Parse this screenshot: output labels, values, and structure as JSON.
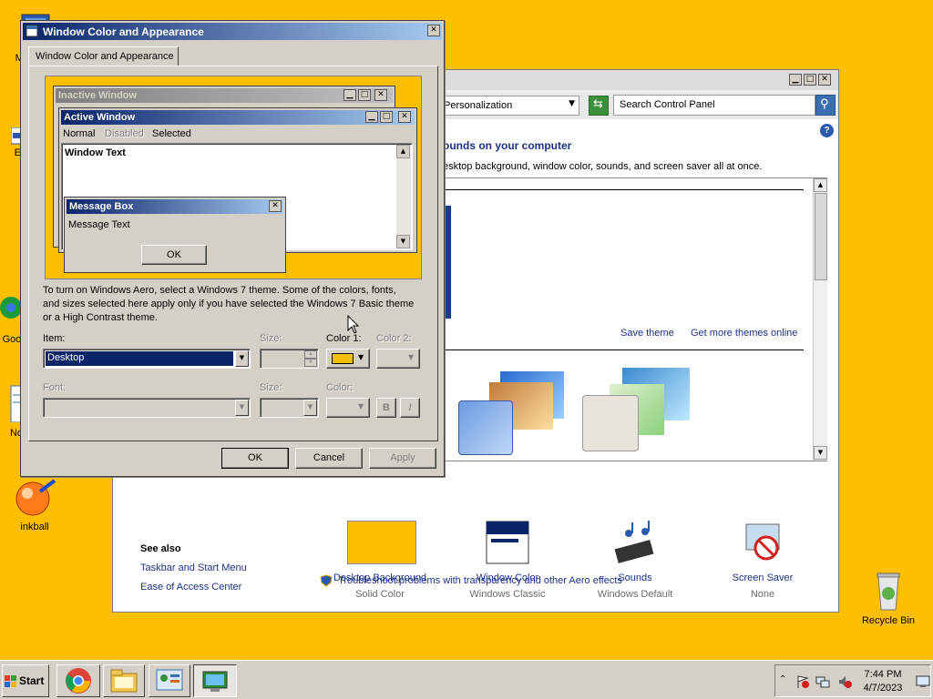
{
  "desktop": {
    "icons": [
      {
        "label": "My",
        "icon": "computer-icon"
      },
      {
        "label": "Ev",
        "icon": "document-icon"
      },
      {
        "label": "Goo",
        "icon": "chrome-icon"
      },
      {
        "label": "No",
        "icon": "notepad-icon"
      },
      {
        "label": "inkball",
        "icon": "inkball-icon"
      },
      {
        "label": "Recycle Bin",
        "icon": "recycle-bin-icon"
      }
    ]
  },
  "personalization": {
    "breadcrumb": "Personalization",
    "search_placeholder": "Search Control Panel",
    "heading": "ounds on your computer",
    "subheading": "esktop background, window color, sounds, and screen saver all at once.",
    "save_theme": "Save theme",
    "get_more_themes": "Get more themes online",
    "bottom_items": [
      {
        "label": "Desktop Background",
        "value": "Solid Color"
      },
      {
        "label": "Window Color",
        "value": "Windows Classic"
      },
      {
        "label": "Sounds",
        "value": "Windows Default"
      },
      {
        "label": "Screen Saver",
        "value": "None"
      }
    ],
    "see_also": {
      "title": "See also",
      "links": [
        "Taskbar and Start Menu",
        "Ease of Access Center"
      ]
    },
    "troubleshoot": "Troubleshoot problems with transparency and other Aero effects"
  },
  "dialog": {
    "title": "Window Color and Appearance",
    "tab": "Window Color and Appearance",
    "preview": {
      "inactive_title": "Inactive Window",
      "active_title": "Active Window",
      "menu": [
        "Normal",
        "Disabled",
        "Selected"
      ],
      "window_text": "Window Text",
      "msgbox_title": "Message Box",
      "msgbox_text": "Message Text",
      "msgbox_ok": "OK"
    },
    "info": "To turn on Windows Aero, select a Windows 7 theme.  Some of the colors, fonts, and sizes selected here apply only if you have selected the Windows 7 Basic theme or a High Contrast theme.",
    "item_label": "Item:",
    "item_value": "Desktop",
    "size_label": "Size:",
    "color1_label": "Color 1:",
    "color2_label": "Color 2:",
    "font_label": "Font:",
    "font_size_label": "Size:",
    "font_color_label": "Color:",
    "bold": "B",
    "italic": "I",
    "ok": "OK",
    "cancel": "Cancel",
    "apply": "Apply"
  },
  "colors": {
    "desktop": "#FFBE00",
    "color1": "#FFBE00"
  },
  "taskbar": {
    "start": "Start",
    "time": "7:44 PM",
    "date": "4/7/2023"
  }
}
